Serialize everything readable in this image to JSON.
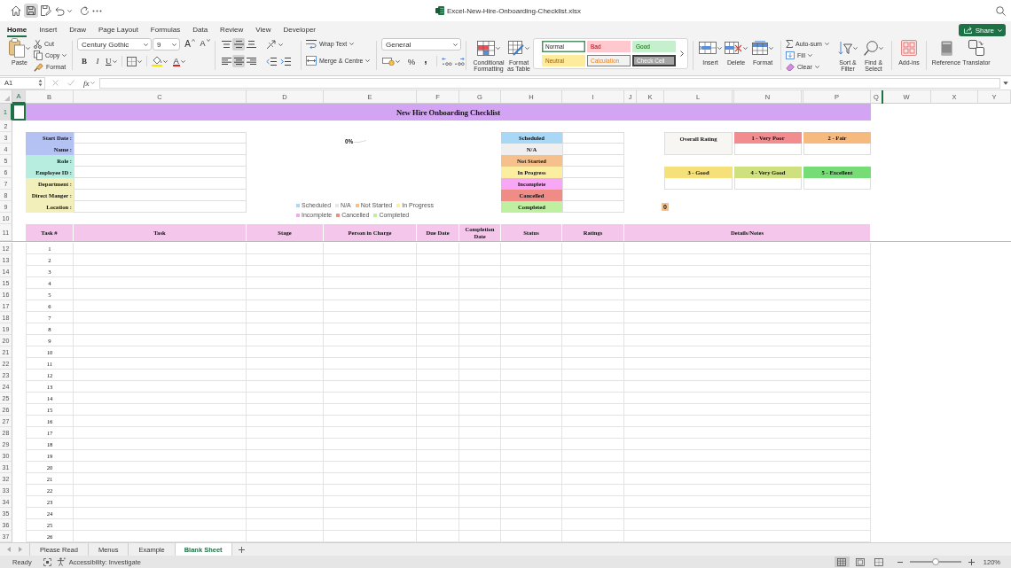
{
  "title_bar": {
    "title": "Excel-New-Hire-Onboarding-Checklist.xlsx"
  },
  "ribbon_tabs": [
    {
      "label": "Home",
      "selected": true
    },
    {
      "label": "Insert",
      "selected": false
    },
    {
      "label": "Draw",
      "selected": false
    },
    {
      "label": "Page Layout",
      "selected": false
    },
    {
      "label": "Formulas",
      "selected": false
    },
    {
      "label": "Data",
      "selected": false
    },
    {
      "label": "Review",
      "selected": false
    },
    {
      "label": "View",
      "selected": false
    },
    {
      "label": "Developer",
      "selected": false
    }
  ],
  "share_button": {
    "label": "Share"
  },
  "ribbon": {
    "clipboard": {
      "paste": "Paste",
      "cut": "Cut",
      "copy": "Copy",
      "format_painter": "Format"
    },
    "font": {
      "name": "Century Gothic",
      "size": "9",
      "grow": "A",
      "shrink": "A",
      "bold": "B",
      "italic": "I",
      "underline": "U",
      "font_color": "A"
    },
    "alignment": {
      "vertical": [
        {
          "kind": "top",
          "selected": false
        },
        {
          "kind": "middle",
          "selected": true
        },
        {
          "kind": "bottom",
          "selected": false
        }
      ],
      "horizontal": [
        {
          "kind": "left",
          "selected": false
        },
        {
          "kind": "center",
          "selected": true
        },
        {
          "kind": "right",
          "selected": false
        }
      ],
      "wrap_text": "Wrap Text",
      "merge": "Merge & Centre"
    },
    "number": {
      "format": "General",
      "percent": "%",
      "comma": ","
    },
    "styles": {
      "conditional_formatting": "Conditional Formatting",
      "format_as_table": "Format as Table",
      "cell_styles": [
        {
          "label": "Normal",
          "kind": "normal",
          "selected": true
        },
        {
          "label": "Bad",
          "kind": "bad",
          "selected": false
        },
        {
          "label": "Good",
          "kind": "good",
          "selected": false
        },
        {
          "label": "Neutral",
          "kind": "neutral",
          "selected": false
        },
        {
          "label": "Calculation",
          "kind": "calculation",
          "selected": false
        },
        {
          "label": "Check Cell",
          "kind": "check",
          "selected": false
        }
      ]
    },
    "cells": {
      "insert": "Insert",
      "delete": "Delete",
      "format": "Format"
    },
    "editing": {
      "autosum": "Auto-sum",
      "fill": "Fill",
      "clear": "Clear",
      "sort_filter": "Sort & Filter",
      "find_select": "Find & Select"
    },
    "add_ins": "Add-ins",
    "reference": "Reference",
    "translator": "Translator"
  },
  "formula_bar": {
    "name_box": "A1",
    "function_label": "fx"
  },
  "columns": [
    {
      "label": "A",
      "selected": true
    },
    {
      "label": "B",
      "selected": false
    },
    {
      "label": "C",
      "selected": false
    },
    {
      "label": "D",
      "selected": false
    },
    {
      "label": "E",
      "selected": false
    },
    {
      "label": "F",
      "selected": false
    },
    {
      "label": "G",
      "selected": false
    },
    {
      "label": "H",
      "selected": false
    },
    {
      "label": "I",
      "selected": false
    },
    {
      "label": "J",
      "selected": false
    },
    {
      "label": "K",
      "selected": false
    },
    {
      "label": "L",
      "selected": false
    },
    {
      "selected": false
    },
    {
      "label": "N",
      "selected": false
    },
    {
      "selected": false
    },
    {
      "label": "P",
      "selected": false
    },
    {
      "label": "Q",
      "selected": false
    },
    {
      "label": "W",
      "selected": false
    },
    {
      "label": "X",
      "selected": false
    },
    {
      "label": "Y",
      "selected": false
    }
  ],
  "rows": [
    {
      "label": "1",
      "selected": true
    },
    {
      "label": "2",
      "selected": false
    },
    {
      "label": "3",
      "selected": false
    },
    {
      "label": "4",
      "selected": false
    },
    {
      "label": "5",
      "selected": false
    },
    {
      "label": "6",
      "selected": false
    },
    {
      "label": "7",
      "selected": false
    },
    {
      "label": "8",
      "selected": false
    },
    {
      "label": "9",
      "selected": false
    },
    {
      "label": "10",
      "selected": false
    },
    {
      "label": "11",
      "selected": false
    },
    {
      "label": "12",
      "selected": false
    },
    {
      "label": "13",
      "selected": false
    },
    {
      "label": "14",
      "selected": false
    },
    {
      "label": "15",
      "selected": false
    },
    {
      "label": "16",
      "selected": false
    },
    {
      "label": "17",
      "selected": false
    },
    {
      "label": "18",
      "selected": false
    },
    {
      "label": "19",
      "selected": false
    },
    {
      "label": "20",
      "selected": false
    },
    {
      "label": "21",
      "selected": false
    },
    {
      "label": "22",
      "selected": false
    },
    {
      "label": "23",
      "selected": false
    },
    {
      "label": "24",
      "selected": false
    },
    {
      "label": "25",
      "selected": false
    },
    {
      "label": "26",
      "selected": false
    },
    {
      "label": "27",
      "selected": false
    },
    {
      "label": "28",
      "selected": false
    },
    {
      "label": "29",
      "selected": false
    },
    {
      "label": "30",
      "selected": false
    },
    {
      "label": "31",
      "selected": false
    },
    {
      "label": "32",
      "selected": false
    },
    {
      "label": "33",
      "selected": false
    },
    {
      "label": "34",
      "selected": false
    },
    {
      "label": "35",
      "selected": false
    },
    {
      "label": "36",
      "selected": false
    },
    {
      "label": "37",
      "selected": false
    }
  ],
  "sheet": {
    "title": "New Hire Onboarding Checklist",
    "employee_fields": [
      {
        "label": "Start Date :",
        "color": "#b3c1f3"
      },
      {
        "label": "Name :",
        "color": "#b3c1f3"
      },
      {
        "label": "Role :",
        "color": "#b7eddf"
      },
      {
        "label": "Employee ID :",
        "color": "#b7eddf"
      },
      {
        "label": "Department :",
        "color": "#f3efbb"
      },
      {
        "label": "Direct Manger :",
        "color": "#f3efbb"
      },
      {
        "label": "Location :",
        "color": "#f3efbb"
      }
    ],
    "status_chart": {
      "data_label": "0%",
      "legend": [
        {
          "label": "Scheduled",
          "color": "#a8d8f5"
        },
        {
          "label": "N/A",
          "color": "#e6e6e6"
        },
        {
          "label": "Not Started",
          "color": "#f5c08c"
        },
        {
          "label": "In Progress",
          "color": "#fbeea0"
        },
        {
          "label": "Incomplete",
          "color": "#f7a7f3"
        },
        {
          "label": "Cancelled",
          "color": "#ef8c86"
        },
        {
          "label": "Completed",
          "color": "#bff0a1"
        }
      ]
    },
    "statuses": [
      {
        "label": "Scheduled",
        "color": "#a8d8f5"
      },
      {
        "label": "N/A",
        "color": "#efefef"
      },
      {
        "label": "Not Started",
        "color": "#f5c08c"
      },
      {
        "label": "In Progress",
        "color": "#fbeea0"
      },
      {
        "label": "Incomplete",
        "color": "#f7a7f3"
      },
      {
        "label": "Cancelled",
        "color": "#ef8c86"
      },
      {
        "label": "Completed",
        "color": "#bff0a1"
      }
    ],
    "rating": {
      "title": "Overall Rating",
      "levels": [
        {
          "label": "1 - Very Poor",
          "color": "#f28c8e"
        },
        {
          "label": "2 - Fair",
          "color": "#f6b97e"
        },
        {
          "label": "3 - Good",
          "color": "#f5e07a"
        },
        {
          "label": "4 - Very Good",
          "color": "#cfe07e"
        },
        {
          "label": "5 - Excellent",
          "color": "#76dc76"
        }
      ]
    },
    "rating_total": "0",
    "task_table": {
      "columns": [
        "Task #",
        "Task",
        "Stage",
        "Person in Charge",
        "Due Date",
        "Completion Date",
        "Status",
        "Ratings",
        "Details/Notes"
      ],
      "task_numbers": [
        "1",
        "2",
        "3",
        "4",
        "5",
        "6",
        "7",
        "8",
        "9",
        "10",
        "11",
        "12",
        "13",
        "14",
        "15",
        "16",
        "17",
        "18",
        "19",
        "20",
        "21",
        "22",
        "23",
        "24",
        "25",
        "26"
      ]
    }
  },
  "sheet_tabs": [
    {
      "label": "Please Read",
      "selected": false
    },
    {
      "label": "Menus",
      "selected": false
    },
    {
      "label": "Example",
      "selected": false
    },
    {
      "label": "Blank Sheet",
      "selected": true
    }
  ],
  "status_bar": {
    "status": "Ready",
    "accessibility": "Accessibility: Investigate",
    "views": [
      {
        "kind": "normal",
        "selected": true
      },
      {
        "kind": "page_layout",
        "selected": false
      },
      {
        "kind": "page_break",
        "selected": false
      }
    ],
    "zoom": {
      "level": 0.5,
      "reading": "120%"
    }
  }
}
